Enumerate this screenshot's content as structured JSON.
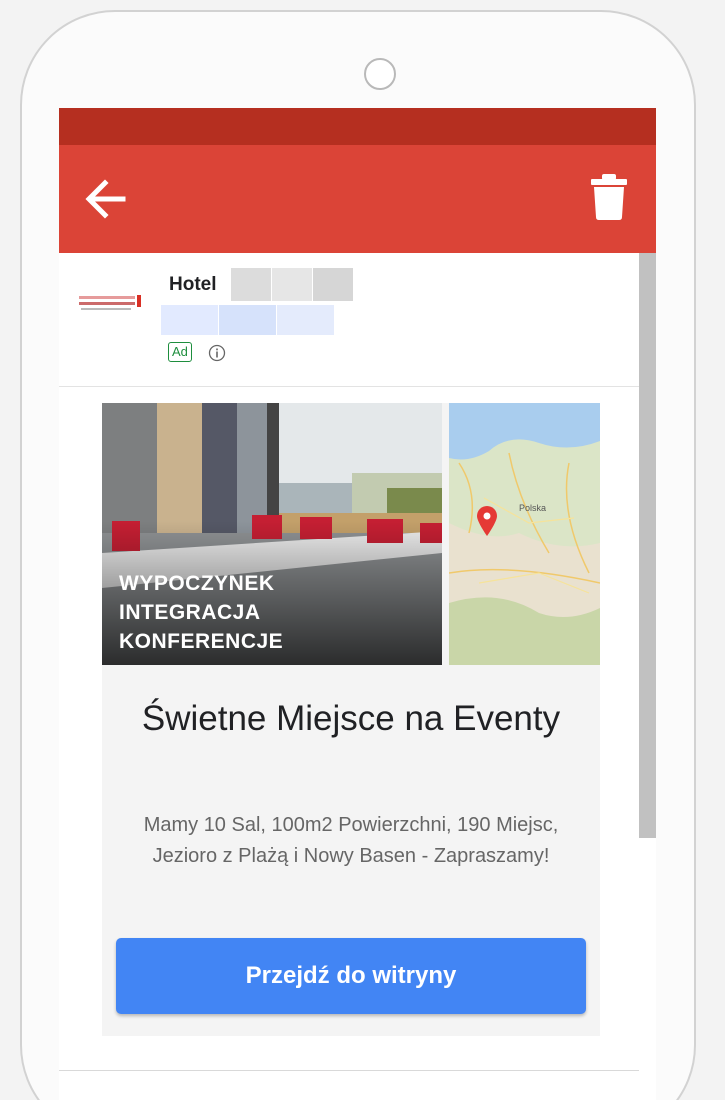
{
  "colors": {
    "status_bar": "#b52f20",
    "app_bar": "#db4437",
    "cta_button": "#4285f4",
    "ad_badge": "#1e8e3e"
  },
  "toolbar": {
    "back_icon": "arrow-left-icon",
    "delete_icon": "trash-icon"
  },
  "sender": {
    "name": "Hotel",
    "ad_label": "Ad",
    "info_icon": "info-icon"
  },
  "ad": {
    "image_lines": [
      "WYPOCZYNEK",
      "INTEGRACJA",
      "KONFERENCJE"
    ],
    "headline": "Świetne Miejsce na Eventy",
    "description": "Mamy 10 Sal, 100m2 Powierzchni, 190 Miejsc, Jezioro z Plażą i Nowy Basen - Zapraszamy!",
    "cta_label": "Przejdź do witryny"
  },
  "map": {
    "country_label": "Polska",
    "pin_icon": "map-pin-icon"
  }
}
